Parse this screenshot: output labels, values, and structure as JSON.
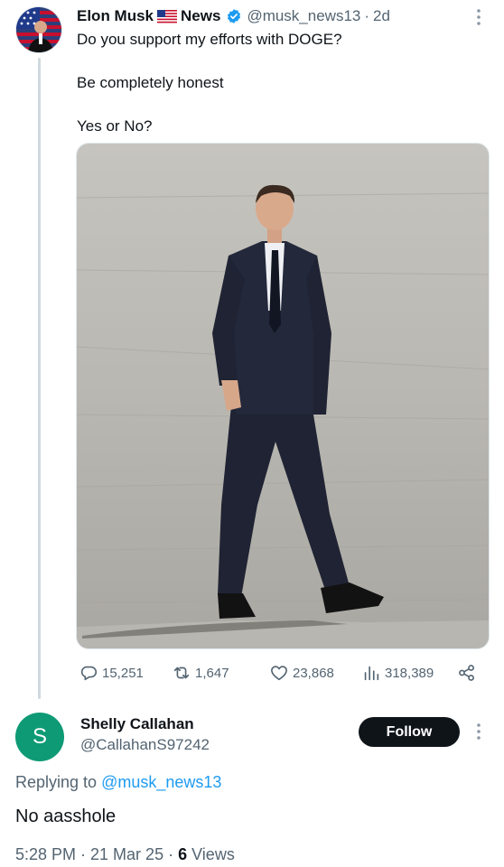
{
  "post": {
    "author_name": "Elon Musk",
    "author_name_suffix": "News",
    "handle": "@musk_news13",
    "separator": "·",
    "time_ago": "2d",
    "text_lines": [
      "Do you support my efforts with DOGE?",
      "Be completely honest",
      "Yes or No?"
    ],
    "media_icon": "photo-man-in-suit-walking",
    "stats": {
      "replies": "15,251",
      "reposts": "1,647",
      "likes": "23,868",
      "views": "318,389"
    }
  },
  "reply": {
    "avatar_letter": "S",
    "author_name": "Shelly Callahan",
    "handle": "@CallahanS97242",
    "follow_label": "Follow",
    "replying_prefix": "Replying to",
    "replying_handle": "@musk_news13",
    "text": "No aasshole",
    "timestamp": "5:28 PM · 21 Mar 25 ·",
    "views_count": "6",
    "views_label": "Views"
  },
  "colors": {
    "accent": "#1d9bf0",
    "avatar_bg": "#0e9a75",
    "secondary_text": "#536471",
    "follow_bg": "#0f1419"
  }
}
